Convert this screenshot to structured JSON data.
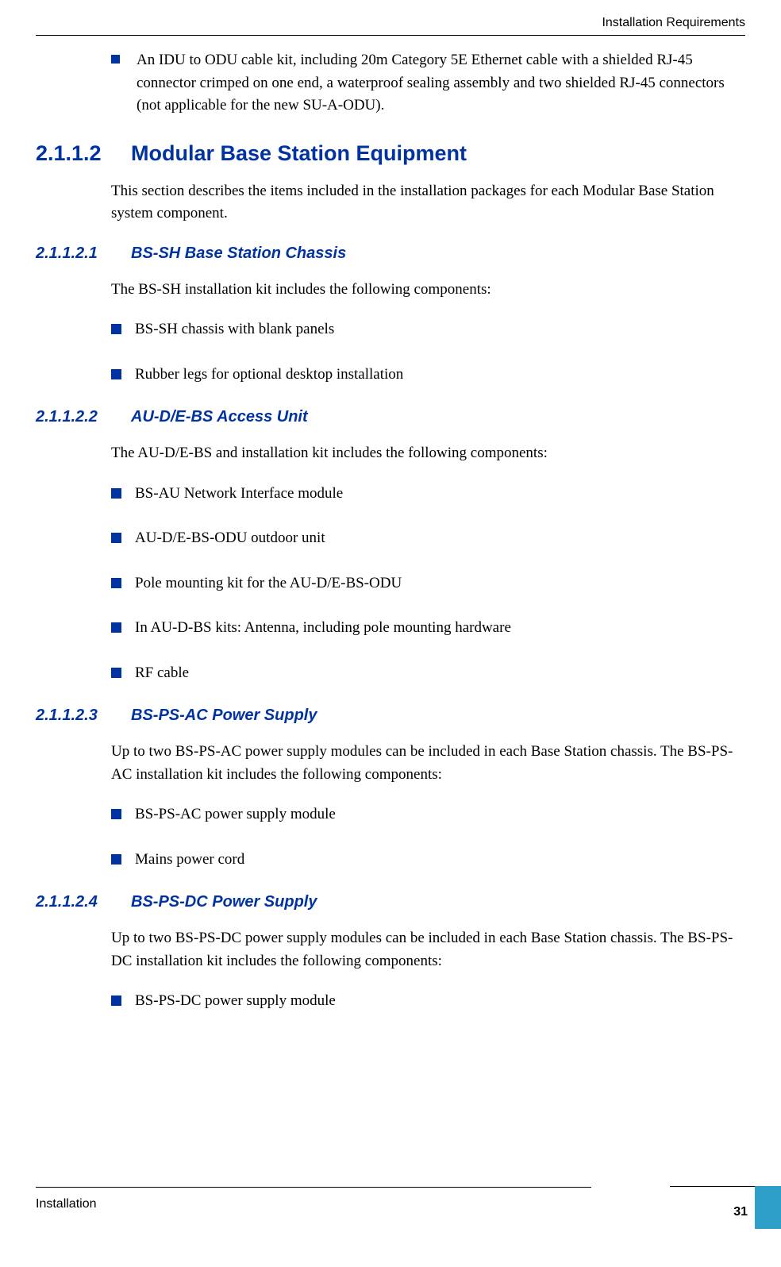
{
  "header": {
    "right": "Installation Requirements"
  },
  "intro_bullet": "An IDU to ODU cable kit, including 20m Category 5E Ethernet cable with a shielded RJ-45 connector crimped on one end, a waterproof sealing assembly and two shielded RJ-45 connectors (not applicable for the new SU-A-ODU).",
  "s2": {
    "num": "2.1.1.2",
    "title": "Modular Base Station Equipment",
    "intro": "This section describes the items included in the installation packages for each Modular Base Station system component."
  },
  "s21": {
    "num": "2.1.1.2.1",
    "title": "BS-SH Base Station Chassis",
    "intro": "The BS-SH installation kit includes the following components:",
    "items": [
      "BS-SH chassis with blank panels",
      "Rubber legs for optional desktop installation"
    ]
  },
  "s22": {
    "num": "2.1.1.2.2",
    "title": "AU-D/E-BS Access Unit",
    "intro": "The AU-D/E-BS and installation kit includes the following components:",
    "items": [
      "BS-AU Network Interface module",
      "AU-D/E-BS-ODU outdoor unit",
      "Pole mounting kit for the AU-D/E-BS-ODU",
      "In AU-D-BS kits: Antenna, including pole mounting hardware",
      "RF cable"
    ]
  },
  "s23": {
    "num": "2.1.1.2.3",
    "title": "BS-PS-AC Power Supply",
    "intro": "Up to two BS-PS-AC power supply modules can be included in each Base Station chassis. The BS-PS-AC installation kit includes the following components:",
    "items": [
      "BS-PS-AC power supply module",
      "Mains power cord"
    ]
  },
  "s24": {
    "num": "2.1.1.2.4",
    "title": "BS-PS-DC Power Supply",
    "intro": "Up to two BS-PS-DC power supply modules can be included in each Base Station chassis. The BS-PS-DC installation kit includes the following components:",
    "items": [
      "BS-PS-DC power supply module"
    ]
  },
  "footer": {
    "left": "Installation",
    "page": "31"
  }
}
